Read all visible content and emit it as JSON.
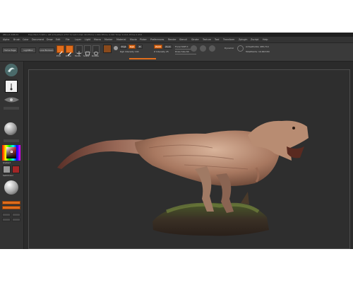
{
  "titlebar": {
    "app_title": "ZBrush 4R8 P2",
    "info": "Free Mem 5.963+ GB  ActiveMem 2757  Scratch Disk 49  ZTime 1.094  RTime 0.016  Timer 0.014  ATime 0.453"
  },
  "menu": {
    "items": [
      "Alpha",
      "Brush",
      "Color",
      "Document",
      "Draw",
      "Edit",
      "File",
      "Layer",
      "Light",
      "Macro",
      "Marker",
      "Material",
      "Movie",
      "Picker",
      "Preferences",
      "Render",
      "Stencil",
      "Stroke",
      "Texture",
      "Tool",
      "Transform",
      "Zplugin",
      "Zscript",
      "Help"
    ]
  },
  "toolbar": {
    "home_page": "Home Page",
    "lightbox": "LightBox",
    "live_boolean": "Live Boolean",
    "edit": "Edit",
    "draw": "Draw",
    "move": "Move",
    "scale": "Scale",
    "rotate": "Rotate",
    "mrgb": "Mrgb",
    "rgb": "Rgb",
    "m": "M",
    "rgb_intensity": "Rgb Intensity 100",
    "zadd": "Zadd",
    "zsub": "Zsub",
    "focal_shift": "Focal Shift 0",
    "draw_size": "Draw Size 64",
    "z_intensity": "Z Intensity 25",
    "dynamic": "Dynamic",
    "active_points": "ActivePoints: 285,714",
    "total_points": "TotalPoints: 19.663 Mil"
  },
  "leftbar": {
    "color_primary": "#9a9a9a",
    "color_secondary": "#a32626",
    "swatch_label": "SwitchColor",
    "gradient_label": "Gradient"
  },
  "colors": {
    "accent": "#e06d1c",
    "canvas": "#2e2e2e",
    "interface": "#3a3a3a"
  }
}
